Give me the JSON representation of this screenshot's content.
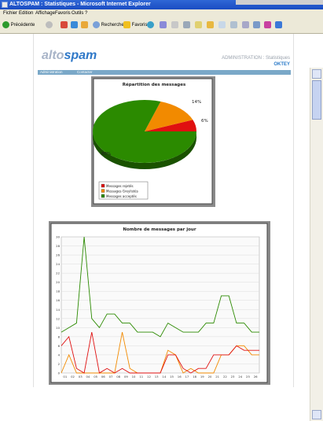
{
  "window": {
    "title": "ALTOSPAM : Statistiques - Microsoft Internet Explorer"
  },
  "menu": [
    "Fichier",
    "Edition",
    "Affichage",
    "Favoris",
    "Outils",
    "?"
  ],
  "toolbar": {
    "back": "Précédente",
    "search": "Rechercher",
    "favorites": "Favoris"
  },
  "logo": {
    "part1": "alto",
    "part2": "spam"
  },
  "header": {
    "section": "ADMINISTRATION : Statistiques",
    "user": "OKTEY"
  },
  "nav": [
    "Administration",
    "Contacter"
  ],
  "colors": {
    "rejected": "#e01010",
    "greylisted": "#f28a00",
    "accepted": "#2b8a00",
    "titlebar": "#1f55c9"
  },
  "chart_data": [
    {
      "type": "pie",
      "title": "Répartition des messages",
      "slices": [
        {
          "name": "Messages rejetés",
          "value": 6,
          "label": "6%"
        },
        {
          "name": "Messages Greylistés",
          "value": 14,
          "label": "14%"
        },
        {
          "name": "Messages acceptés",
          "value": 80,
          "label": "80%"
        }
      ],
      "legend": "bottom-left"
    },
    {
      "type": "line",
      "title": "Nombre de messages par jour",
      "x": [
        "01",
        "02",
        "03",
        "04",
        "05",
        "06",
        "07",
        "08",
        "09",
        "10",
        "11",
        "12",
        "13",
        "14",
        "15",
        "16",
        "17",
        "18",
        "19",
        "20",
        "21",
        "22",
        "23",
        "24",
        "25",
        "26"
      ],
      "yticks": [
        0,
        2,
        4,
        6,
        8,
        10,
        12,
        14,
        16,
        18,
        20,
        22,
        24,
        26,
        28,
        30
      ],
      "ylim": [
        0,
        30
      ],
      "grid": true,
      "series": [
        {
          "name": "Messages acceptés",
          "values": [
            9,
            10,
            11,
            30,
            12,
            10,
            13,
            13,
            11,
            11,
            9,
            9,
            9,
            8,
            11,
            10,
            9,
            9,
            9,
            11,
            11,
            17,
            17,
            11,
            11,
            9,
            9
          ]
        },
        {
          "name": "Messages Greylistés",
          "values": [
            0,
            4,
            0,
            0,
            0,
            0,
            0,
            0,
            9,
            1,
            0,
            0,
            0,
            0,
            5,
            4,
            0,
            1,
            0,
            0,
            0,
            4,
            4,
            6,
            6,
            4,
            4
          ]
        },
        {
          "name": "Messages rejetés",
          "values": [
            6,
            8,
            1,
            0,
            9,
            0,
            1,
            0,
            1,
            0,
            0,
            0,
            0,
            0,
            4,
            4,
            1,
            0,
            1,
            1,
            4,
            4,
            4,
            6,
            5,
            5,
            5
          ]
        }
      ]
    }
  ]
}
